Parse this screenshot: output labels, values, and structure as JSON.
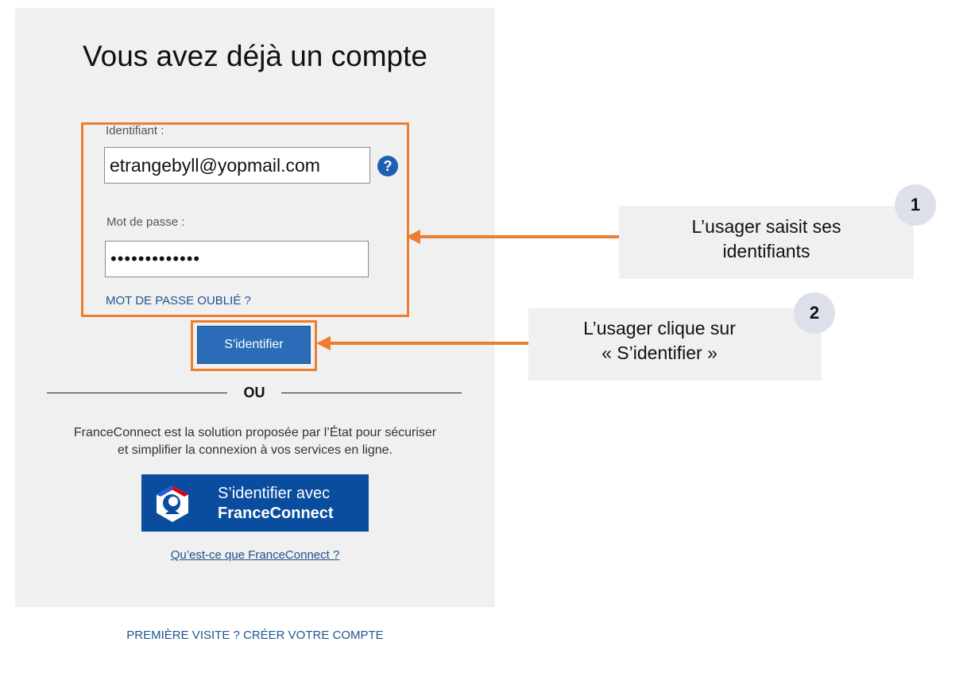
{
  "login": {
    "title": "Vous avez déjà un compte",
    "identifier_label": "Identifiant :",
    "identifier_value": "etrangebyll@yopmail.com",
    "help_icon_glyph": "?",
    "password_label": "Mot de passe :",
    "password_value": "•••••••••••••",
    "forgot_password_link": "MOT DE PASSE OUBLIÉ ?",
    "submit_button": "S'identifier",
    "separator": "OU",
    "franceconnect_description_line1": "FranceConnect est la solution proposée par l’État pour sécuriser",
    "franceconnect_description_line2": "et simplifier la connexion à vos services en ligne.",
    "franceconnect_button_line1": "S’identifier avec",
    "franceconnect_button_line2": "FranceConnect",
    "franceconnect_info_link": "Qu’est-ce que FranceConnect ?",
    "first_visit_link": "PREMIÈRE VISITE ? CRÉER VOTRE COMPTE"
  },
  "annotations": [
    {
      "number": "1",
      "text_line1": "L’usager saisit ses",
      "text_line2": "identifiants"
    },
    {
      "number": "2",
      "text_line1": "L’usager clique sur",
      "text_line2": "« S’identifier »"
    }
  ],
  "colors": {
    "panel_bg": "#f0f0f0",
    "primary_blue": "#2b6cb8",
    "franceconnect_blue": "#0a4d9e",
    "link_blue": "#1f5590",
    "highlight_orange": "#ed7d31",
    "badge_bg": "#dde0ea"
  },
  "icons": {
    "help": "question-circle-icon",
    "franceconnect_logo": "marianne-hexagon-icon"
  }
}
